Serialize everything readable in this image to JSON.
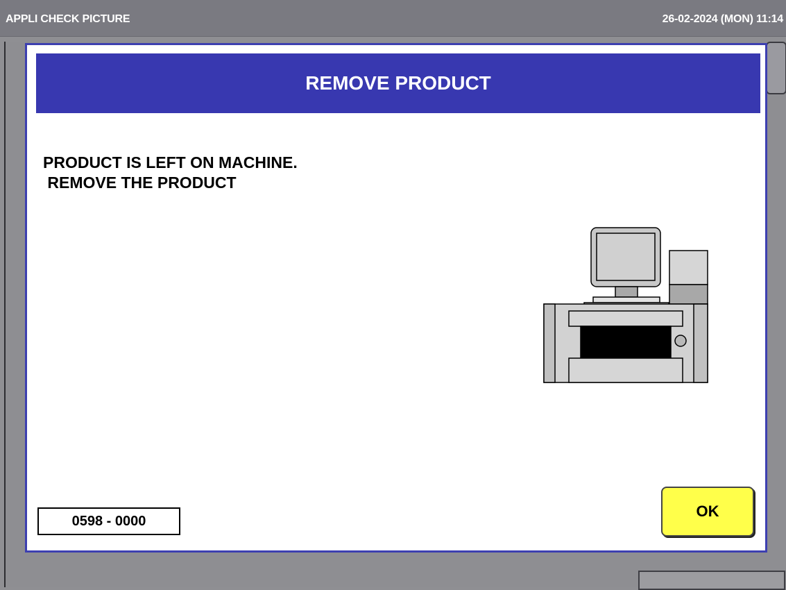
{
  "topbar": {
    "title": "APPLI CHECK PICTURE",
    "datetime": "26-02-2024 (MON)  11:14"
  },
  "dialog": {
    "title": "REMOVE PRODUCT",
    "message": "PRODUCT IS LEFT ON MACHINE.\n REMOVE THE PRODUCT",
    "illustration_icon": "weighing-wrapping-machine-icon",
    "code": "0598 - 0000",
    "ok_label": "OK"
  },
  "colors": {
    "dialog_header": "#3838b0",
    "dialog_border": "#3d3fb0",
    "ok_button": "#ffff4a",
    "topbar": "#7a7a81",
    "background": "#8f8f93"
  }
}
